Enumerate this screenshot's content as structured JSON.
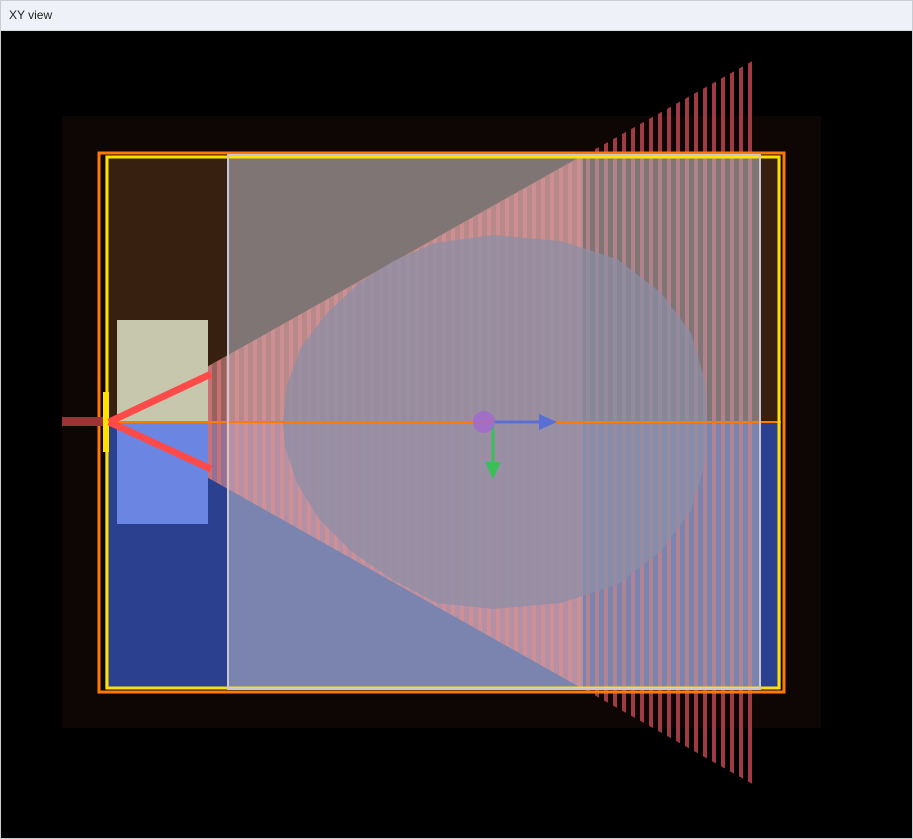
{
  "window": {
    "title": "XY view"
  },
  "scene": {
    "colors": {
      "background": "#000000",
      "room_outer": "#0e0505",
      "wall_upper": "#37200f",
      "wall_lower": "#2b4190",
      "selection_orange": "#ff7a00",
      "selection_yellow": "#ffe100",
      "frustum_fill": "#e59a9a",
      "stripe": "#b0404a",
      "sphere": "#8a8fa6",
      "light_box": "#c7c7ad",
      "blue_box": "#6b86e2",
      "camera_red": "#ff4a4a",
      "gizmo_x": "#5a6fd6",
      "gizmo_y": "#3bbf59",
      "gizmo_origin": "#a36acd"
    },
    "icons": [
      "camera-icon",
      "gizmo-origin-icon",
      "x-axis-arrow-icon",
      "y-axis-arrow-icon"
    ]
  }
}
